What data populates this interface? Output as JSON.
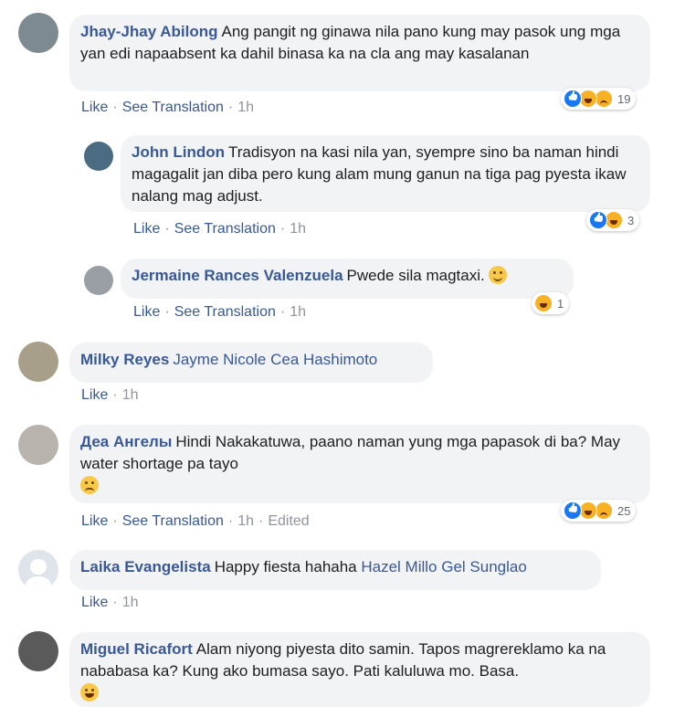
{
  "actions": {
    "like": "Like",
    "see_translation": "See Translation",
    "edited": "Edited"
  },
  "comments": [
    {
      "name": "Jhay-Jhay Abilong",
      "text": "Ang pangit ng ginawa nila pano kung may pasok ung mga yan edi napaabsent ka dahil binasa ka na cla ang may kasalanan",
      "time": "1h",
      "reactions": [
        "like",
        "haha",
        "sad"
      ],
      "reaction_count": "19"
    },
    {
      "name": "John Lindon",
      "text": "Tradisyon na kasi nila yan, syempre sino ba naman hindi magagalit jan diba pero kung alam mung ganun na tiga pag pyesta ikaw nalang mag adjust.",
      "time": "1h",
      "reactions": [
        "like",
        "haha"
      ],
      "reaction_count": "3"
    },
    {
      "name": "Jermaine Rances Valenzuela",
      "text": "Pwede sila magtaxi.",
      "emoji": "smile",
      "time": "1h",
      "reactions": [
        "haha"
      ],
      "reaction_count": "1"
    },
    {
      "name": "Milky Reyes",
      "tag": "Jayme Nicole Cea Hashimoto",
      "time": "1h"
    },
    {
      "name": "Деа Ангелы",
      "text": "Hindi Nakakatuwa, paano naman yung mga papasok di ba? May water shortage pa tayo",
      "emoji": "eye-roll",
      "time": "1h",
      "reactions": [
        "like",
        "haha",
        "sad"
      ],
      "reaction_count": "25"
    },
    {
      "name": "Laika Evangelista",
      "text": "Happy fiesta hahaha",
      "tag": "Hazel Millo Gel Sunglao",
      "time": "1h"
    },
    {
      "name": "Miguel Ricafort",
      "text": "Alam niyong piyesta dito samin. Tapos magrereklamo ka na nababasa ka? Kung ako bumasa sayo. Pati kaluluwa mo. Basa.",
      "emoji": "laugh",
      "time": ""
    }
  ],
  "colors": {
    "link": "#385898",
    "bubble": "#f2f3f5",
    "meta": "#90949c"
  }
}
